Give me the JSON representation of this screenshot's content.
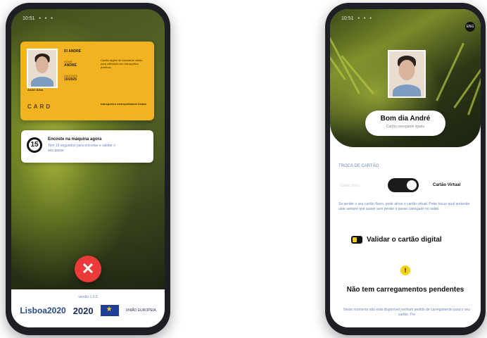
{
  "left_phone": {
    "status_time": "10:51",
    "card": {
      "header": "ID ANDRÉ",
      "field1_label": "NOME",
      "field1_value": "ANDRÉ",
      "field2_label": "VALIDADE",
      "field2_value": "10/2025",
      "holder_name": "André Silva",
      "brand": "CARD",
      "side_text": "Cartão digital de estudante válido para utilização em transportes públicos.",
      "bottom_text": "transportes metropolitanos lisboa"
    },
    "notification": {
      "count": "15",
      "title": "Encoste na máquina agora",
      "body": "Tem 15 segundos para encostar e validar o seu passe"
    },
    "close_symbol": "✕",
    "footer": {
      "version": "versão 1.0.5",
      "logo1": "Lisboa2020",
      "logo2": "2020",
      "logo3": "UNIÃO EUROPEIA"
    }
  },
  "right_phone": {
    "status_time": "10:51",
    "corner_button": "ENG",
    "greeting": "Bom dia André",
    "card_subtitle": "Cartão navegante ligado",
    "section_label": "TROCA DE CARTÃO",
    "toggle_left_label": "Cartão físico",
    "toggle_right_label": "Cartão Virtual",
    "info_text": "Se perder o seu cartão físico, pode ativar o cartão virtual. Pode trocar qual pretende usar sempre que quiser sem perder o passe carregado no saldo.",
    "validate_label": "Validar o cartão digital",
    "warn_symbol": "!",
    "pending_title": "Não tem carregamentos pendentes",
    "pending_body": "Neste momento não está disponível nenhum pedido de carregamento para o seu cartão. Por"
  }
}
